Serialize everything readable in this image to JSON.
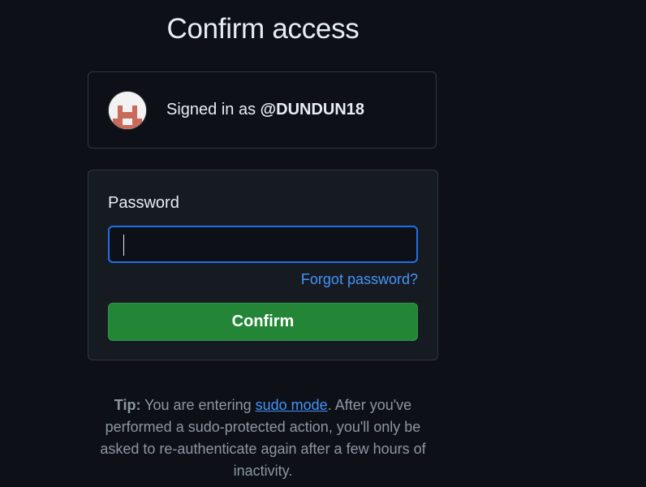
{
  "page": {
    "title": "Confirm access"
  },
  "account": {
    "signed_in_prefix": "Signed in as",
    "username": "@DUNDUN18"
  },
  "form": {
    "password_label": "Password",
    "password_value": "",
    "forgot_link": "Forgot password?",
    "confirm_button": "Confirm"
  },
  "tip": {
    "label": "Tip:",
    "before_link": "You are entering",
    "link_text": "sudo mode",
    "after_link": ". After you've performed a sudo-protected action, you'll only be asked to re-authenticate again after a few hours of inactivity."
  },
  "colors": {
    "background": "#0d1117",
    "box_background": "#161b22",
    "border": "#30363d",
    "link": "#4493f8",
    "button_green": "#238636",
    "focus_border": "#1f6feb"
  },
  "icons": {
    "avatar": "pixel-avatar"
  }
}
